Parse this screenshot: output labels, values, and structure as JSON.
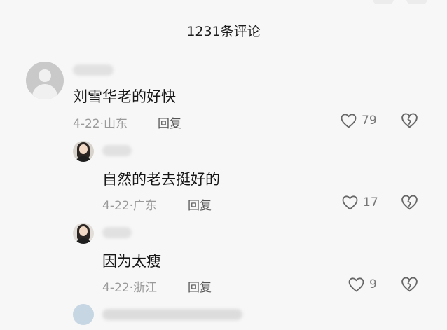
{
  "header": {
    "title": "1231条评论"
  },
  "comments": [
    {
      "text": "刘雪华老的好快",
      "date": "4-22",
      "location": "山东",
      "reply_label": "回复",
      "likes": "79"
    },
    {
      "text": "自然的老去挺好的",
      "date": "4-22",
      "location": "广东",
      "reply_label": "回复",
      "likes": "17"
    },
    {
      "text": "因为太瘦",
      "date": "4-22",
      "location": "浙江",
      "reply_label": "回复",
      "likes": "9"
    }
  ],
  "meta_separator": "·"
}
